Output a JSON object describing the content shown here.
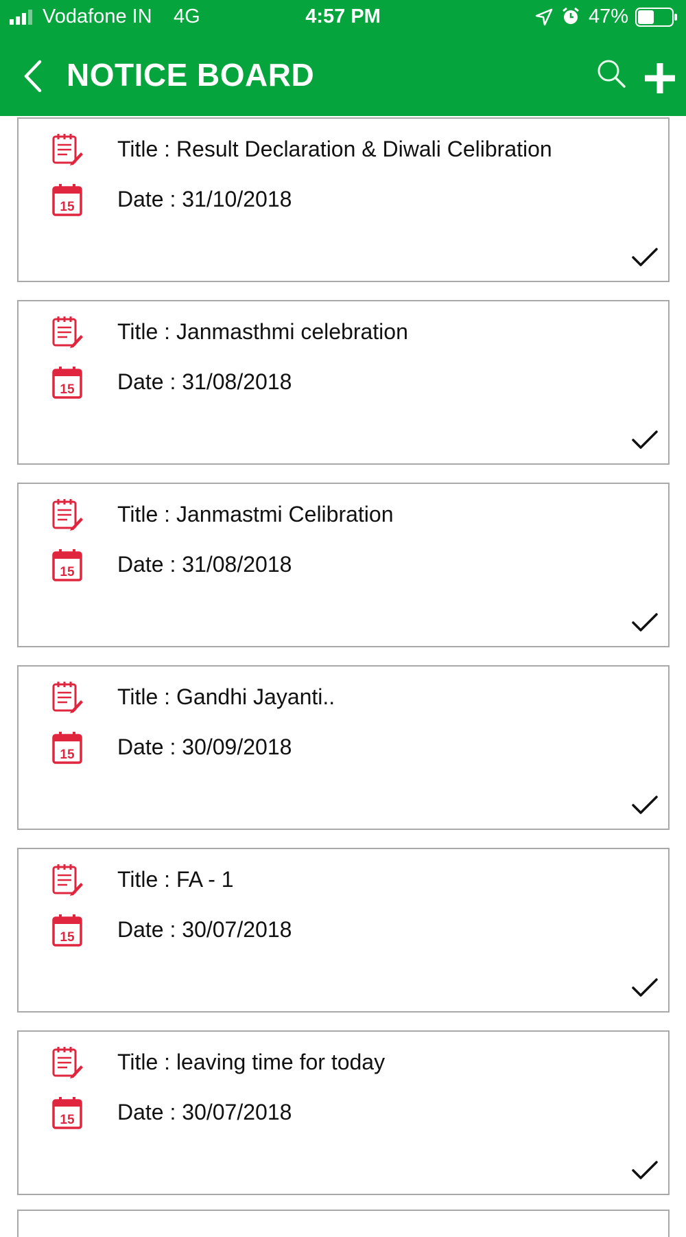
{
  "status_bar": {
    "carrier": "Vodafone IN",
    "network": "4G",
    "time": "4:57 PM",
    "battery": "47%",
    "battery_level": 0.47
  },
  "navbar": {
    "title": "NOTICE BOARD",
    "back_icon": "chevron-left-icon",
    "search_icon": "search-icon",
    "add_icon": "plus-icon"
  },
  "colors": {
    "header": "#05a43c",
    "icon_accent": "#e0263e",
    "card_border": "#a9a9a9"
  },
  "notices": [
    {
      "title": "Title : Result Declaration & Diwali Celibration",
      "date": "Date : 31/10/2018"
    },
    {
      "title": "Title : Janmasthmi celebration",
      "date": "Date : 31/08/2018"
    },
    {
      "title": "Title : Janmastmi Celibration",
      "date": "Date : 31/08/2018"
    },
    {
      "title": "Title : Gandhi Jayanti..",
      "date": "Date : 30/09/2018"
    },
    {
      "title": "Title : FA - 1",
      "date": "Date : 30/07/2018"
    },
    {
      "title": "Title : leaving time for today",
      "date": "Date : 30/07/2018"
    }
  ],
  "calendar_icon_day": "15"
}
